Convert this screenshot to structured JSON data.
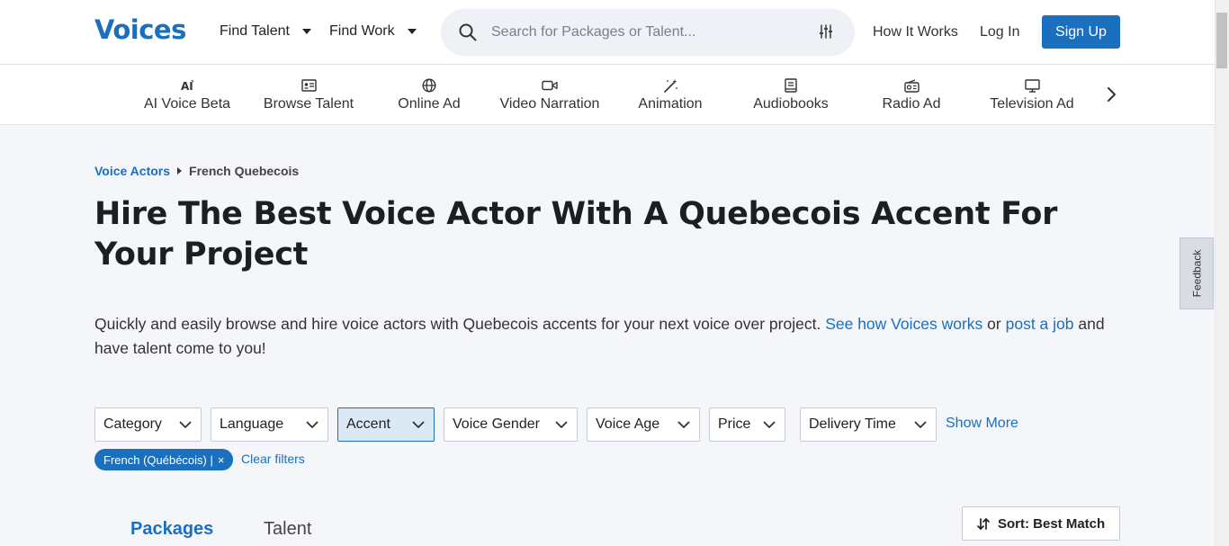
{
  "header": {
    "logo": "Voices",
    "find_talent": "Find Talent",
    "find_work": "Find Work",
    "search_placeholder": "Search for Packages or Talent...",
    "how_it_works": "How It Works",
    "log_in": "Log In",
    "sign_up": "Sign Up"
  },
  "categories": [
    {
      "label": "AI Voice Beta",
      "icon": "ai-icon"
    },
    {
      "label": "Browse Talent",
      "icon": "id-card-icon"
    },
    {
      "label": "Online Ad",
      "icon": "globe-icon"
    },
    {
      "label": "Video Narration",
      "icon": "video-camera-icon"
    },
    {
      "label": "Animation",
      "icon": "magic-wand-icon"
    },
    {
      "label": "Audiobooks",
      "icon": "book-icon"
    },
    {
      "label": "Radio Ad",
      "icon": "radio-icon"
    },
    {
      "label": "Television Ad",
      "icon": "monitor-icon"
    }
  ],
  "breadcrumb": {
    "parent": "Voice Actors",
    "current": "French Quebecois"
  },
  "title": "Hire The Best Voice Actor With A Quebecois Accent For Your Project",
  "description": {
    "text": "Quickly and easily browse and hire voice actors with Quebecois accents for your next voice over project.",
    "link1": "See how Voices works",
    "connector": "or",
    "link2": "post a job",
    "tail": "and have talent come to you!"
  },
  "filters": {
    "category": "Category",
    "language": "Language",
    "accent": "Accent",
    "voice_gender": "Voice Gender",
    "voice_age": "Voice Age",
    "price": "Price",
    "delivery_time": "Delivery Time",
    "show_more": "Show More"
  },
  "active_filter": {
    "label": "French (Québécois) |",
    "remove": "×",
    "clear": "Clear filters"
  },
  "tabs": {
    "packages": "Packages",
    "talent": "Talent"
  },
  "sort": {
    "label": "Sort: Best Match"
  },
  "feedback": "Feedback",
  "colors": {
    "brand": "#1a6fbf",
    "page_bg": "#f4f6f9",
    "active_filter_bg": "#dbe9f7"
  }
}
